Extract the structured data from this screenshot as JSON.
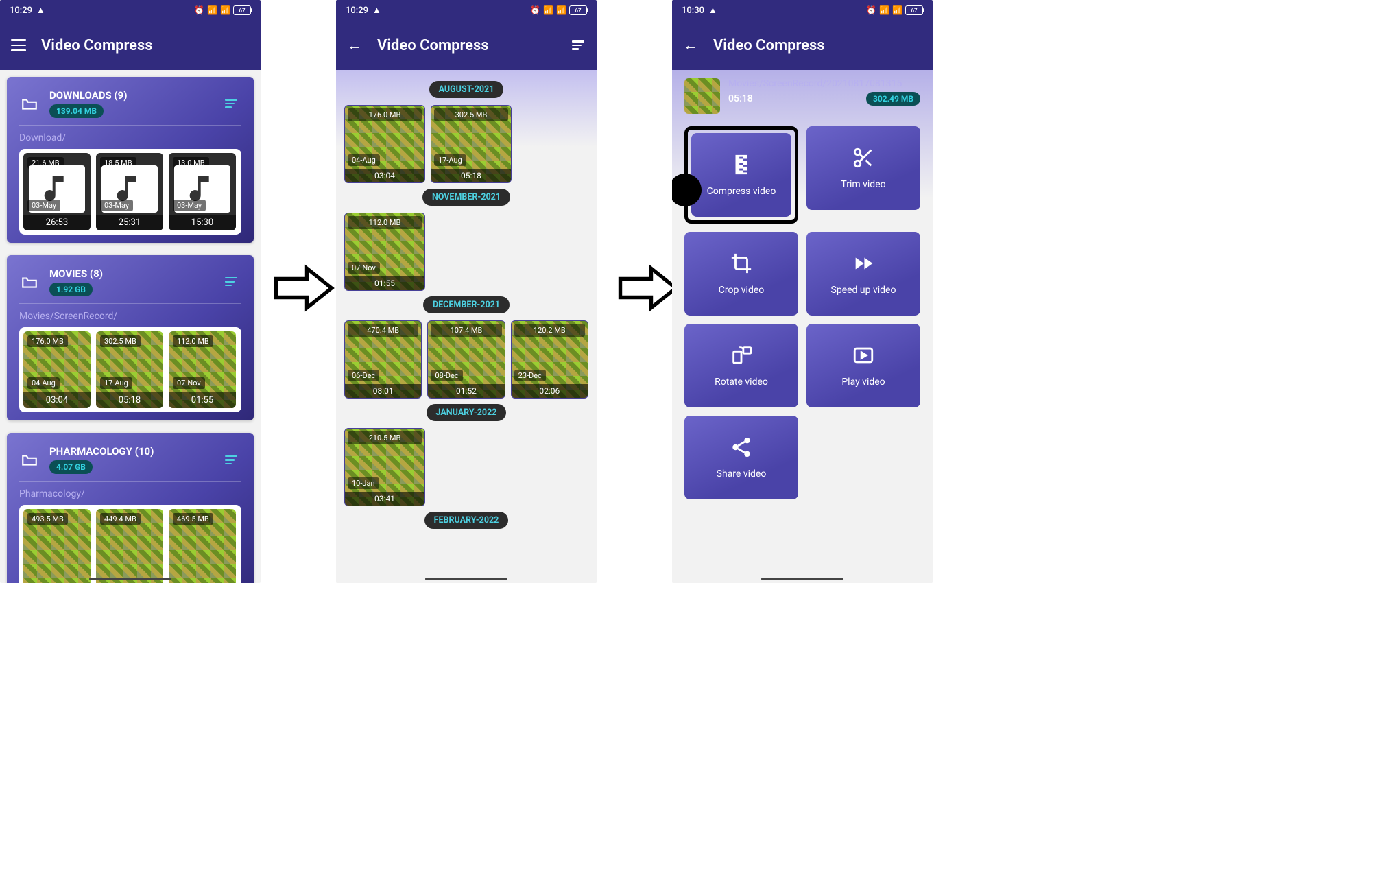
{
  "screen1": {
    "status_time": "10:29",
    "status_battery": "67",
    "app_title": "Video Compress",
    "folders": [
      {
        "title": "DOWNLOADS (9)",
        "size": "139.04 MB",
        "path": "Download/",
        "thumbs": [
          {
            "size": "21.6 MB",
            "date": "03-May",
            "dur": "26:53",
            "type": "music"
          },
          {
            "size": "18.5 MB",
            "date": "03-May",
            "dur": "25:31",
            "type": "music"
          },
          {
            "size": "13.0 MB",
            "date": "03-May",
            "dur": "15:30",
            "type": "music"
          }
        ]
      },
      {
        "title": "MOVIES (8)",
        "size": "1.92 GB",
        "path": "Movies/ScreenRecord/",
        "thumbs": [
          {
            "size": "176.0 MB",
            "date": "04-Aug",
            "dur": "03:04",
            "type": "game"
          },
          {
            "size": "302.5 MB",
            "date": "17-Aug",
            "dur": "05:18",
            "type": "game"
          },
          {
            "size": "112.0 MB",
            "date": "07-Nov",
            "dur": "01:55",
            "type": "game"
          }
        ]
      },
      {
        "title": "PHARMACOLOGY (10)",
        "size": "4.07 GB",
        "path": "Pharmacology/",
        "thumbs": [
          {
            "size": "493.5 MB",
            "date": "",
            "dur": "",
            "type": "game"
          },
          {
            "size": "449.4 MB",
            "date": "",
            "dur": "",
            "type": "game"
          },
          {
            "size": "469.5 MB",
            "date": "",
            "dur": "",
            "type": "game"
          }
        ]
      }
    ]
  },
  "screen2": {
    "status_time": "10:29",
    "status_battery": "67",
    "app_title": "Video Compress",
    "months": [
      {
        "label": "AUGUST-2021",
        "videos": [
          {
            "size": "176.0 MB",
            "date": "04-Aug",
            "dur": "03:04"
          },
          {
            "size": "302.5 MB",
            "date": "17-Aug",
            "dur": "05:18"
          }
        ]
      },
      {
        "label": "NOVEMBER-2021",
        "videos": [
          {
            "size": "112.0 MB",
            "date": "07-Nov",
            "dur": "01:55"
          }
        ]
      },
      {
        "label": "DECEMBER-2021",
        "videos": [
          {
            "size": "470.4 MB",
            "date": "06-Dec",
            "dur": "08:01"
          },
          {
            "size": "107.4 MB",
            "date": "08-Dec",
            "dur": "01:52"
          },
          {
            "size": "120.2 MB",
            "date": "23-Dec",
            "dur": "02:06"
          }
        ]
      },
      {
        "label": "JANUARY-2022",
        "videos": [
          {
            "size": "210.5 MB",
            "date": "10-Jan",
            "dur": "03:41"
          }
        ]
      },
      {
        "label": "FEBRUARY-2022",
        "videos": []
      }
    ]
  },
  "screen3": {
    "status_time": "10:30",
    "status_battery": "67",
    "app_title": "Video Compress",
    "file_path": "Movies/ScreenRecord/20210817081315",
    "file_duration": "05:18",
    "file_size": "302.49 MB",
    "actions": [
      {
        "label": "Compress video",
        "icon": "compress",
        "highlight": true
      },
      {
        "label": "Trim video",
        "icon": "trim"
      },
      {
        "label": "Crop video",
        "icon": "crop"
      },
      {
        "label": "Speed up video",
        "icon": "speed"
      },
      {
        "label": "Rotate video",
        "icon": "rotate"
      },
      {
        "label": "Play video",
        "icon": "play"
      },
      {
        "label": "Share video",
        "icon": "share"
      }
    ]
  }
}
